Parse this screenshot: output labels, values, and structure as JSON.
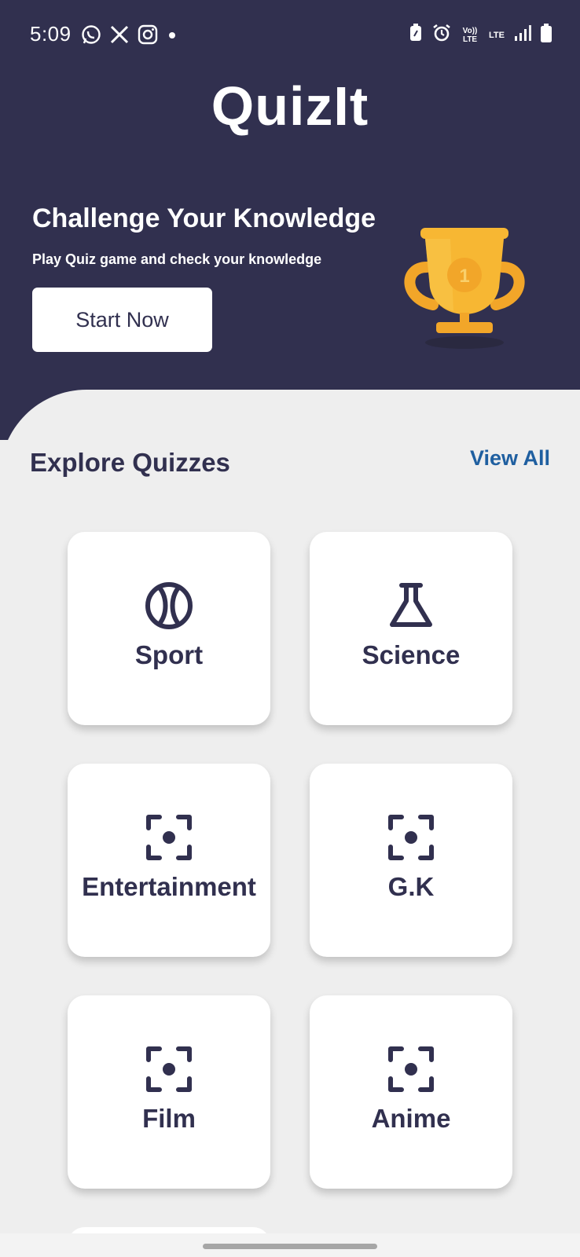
{
  "status_bar": {
    "time": "5:09",
    "left_icons": [
      "whatsapp-icon",
      "x-icon",
      "instagram-icon",
      "dot-icon"
    ],
    "right_icons": [
      "battery-saver-icon",
      "alarm-icon",
      "volte-icon",
      "lte-icon",
      "signal-icon",
      "battery-icon"
    ],
    "volte_label": "Vo)) LTE",
    "lte_label": "LTE"
  },
  "app": {
    "title": "QuizIt"
  },
  "hero": {
    "title": "Challenge Your Knowledge",
    "subtitle": "Play Quiz game and check your knowledge",
    "start_label": "Start Now",
    "illustration": "trophy-icon"
  },
  "explore": {
    "title": "Explore Quizzes",
    "view_all_label": "View All"
  },
  "categories": [
    {
      "label": "Sport",
      "icon": "baseball-icon"
    },
    {
      "label": "Science",
      "icon": "flask-icon"
    },
    {
      "label": "Entertainment",
      "icon": "focus-icon"
    },
    {
      "label": "G.K",
      "icon": "focus-icon"
    },
    {
      "label": "Film",
      "icon": "focus-icon"
    },
    {
      "label": "Anime",
      "icon": "focus-icon"
    }
  ],
  "colors": {
    "header_bg": "#31304f",
    "content_bg": "#eeeeee",
    "accent_link": "#1f5fa0",
    "trophy_gold": "#f7b733"
  }
}
